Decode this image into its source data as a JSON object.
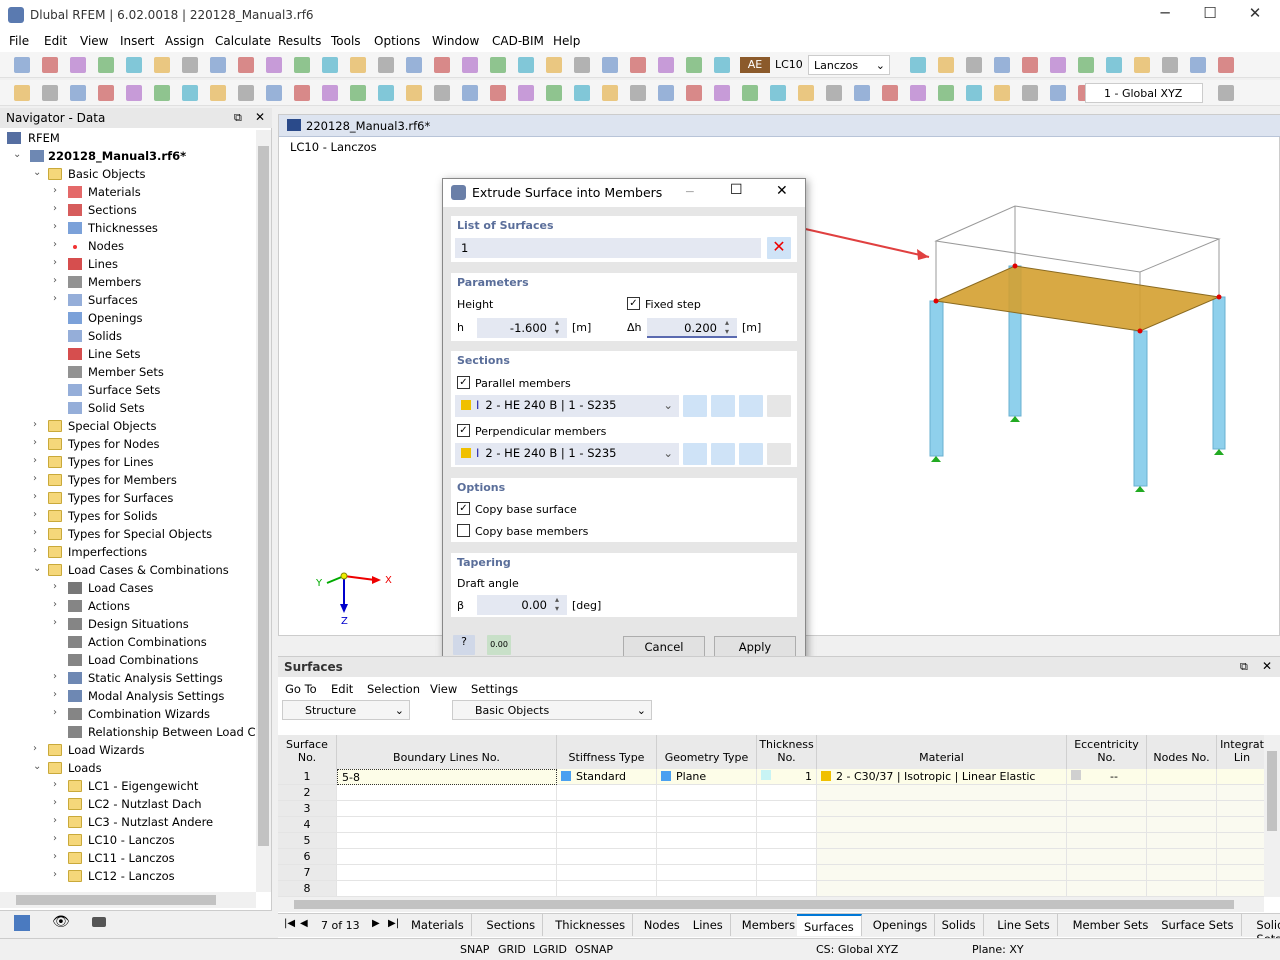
{
  "window": {
    "title": "Dlubal RFEM | 6.02.0018 | 220128_Manual3.rf6",
    "minimize": "─",
    "maximize": "☐",
    "close": "✕"
  },
  "menu": [
    "File",
    "Edit",
    "View",
    "Insert",
    "Assign",
    "Calculate",
    "Results",
    "Tools",
    "Options",
    "Window",
    "CAD-BIM",
    "Help"
  ],
  "toolbar": {
    "load_badge": "AE",
    "load_case": "LC10",
    "load_name": "Lanczos",
    "coord_system": "1 - Global XYZ"
  },
  "navigator": {
    "title": "Navigator - Data",
    "items": [
      {
        "label": "RFEM",
        "level": 0,
        "exp": "none",
        "icon": "rfem"
      },
      {
        "label": "220128_Manual3.rf6*",
        "level": 0,
        "exp": "open",
        "icon": "model",
        "bold": true
      },
      {
        "label": "Basic Objects",
        "level": 1,
        "exp": "open",
        "icon": "folder"
      },
      {
        "label": "Materials",
        "level": 2,
        "exp": "closed",
        "icon": "materials"
      },
      {
        "label": "Sections",
        "level": 2,
        "exp": "closed",
        "icon": "sections"
      },
      {
        "label": "Thicknesses",
        "level": 2,
        "exp": "closed",
        "icon": "thickness"
      },
      {
        "label": "Nodes",
        "level": 2,
        "exp": "closed",
        "icon": "node"
      },
      {
        "label": "Lines",
        "level": 2,
        "exp": "closed",
        "icon": "line"
      },
      {
        "label": "Members",
        "level": 2,
        "exp": "closed",
        "icon": "member"
      },
      {
        "label": "Surfaces",
        "level": 2,
        "exp": "closed",
        "icon": "surface"
      },
      {
        "label": "Openings",
        "level": 2,
        "exp": "none",
        "icon": "opening"
      },
      {
        "label": "Solids",
        "level": 2,
        "exp": "none",
        "icon": "solid"
      },
      {
        "label": "Line Sets",
        "level": 2,
        "exp": "none",
        "icon": "line"
      },
      {
        "label": "Member Sets",
        "level": 2,
        "exp": "none",
        "icon": "member"
      },
      {
        "label": "Surface Sets",
        "level": 2,
        "exp": "none",
        "icon": "surface"
      },
      {
        "label": "Solid Sets",
        "level": 2,
        "exp": "none",
        "icon": "solid"
      },
      {
        "label": "Special Objects",
        "level": 1,
        "exp": "closed",
        "icon": "folder"
      },
      {
        "label": "Types for Nodes",
        "level": 1,
        "exp": "closed",
        "icon": "folder"
      },
      {
        "label": "Types for Lines",
        "level": 1,
        "exp": "closed",
        "icon": "folder"
      },
      {
        "label": "Types for Members",
        "level": 1,
        "exp": "closed",
        "icon": "folder"
      },
      {
        "label": "Types for Surfaces",
        "level": 1,
        "exp": "closed",
        "icon": "folder"
      },
      {
        "label": "Types for Solids",
        "level": 1,
        "exp": "closed",
        "icon": "folder"
      },
      {
        "label": "Types for Special Objects",
        "level": 1,
        "exp": "closed",
        "icon": "folder"
      },
      {
        "label": "Imperfections",
        "level": 1,
        "exp": "closed",
        "icon": "folder"
      },
      {
        "label": "Load Cases & Combinations",
        "level": 1,
        "exp": "open",
        "icon": "folder"
      },
      {
        "label": "Load Cases",
        "level": 2,
        "exp": "closed",
        "icon": "loadcase"
      },
      {
        "label": "Actions",
        "level": 2,
        "exp": "closed",
        "icon": "action"
      },
      {
        "label": "Design Situations",
        "level": 2,
        "exp": "closed",
        "icon": "action"
      },
      {
        "label": "Action Combinations",
        "level": 2,
        "exp": "none",
        "icon": "action"
      },
      {
        "label": "Load Combinations",
        "level": 2,
        "exp": "none",
        "icon": "action"
      },
      {
        "label": "Static Analysis Settings",
        "level": 2,
        "exp": "closed",
        "icon": "static"
      },
      {
        "label": "Modal Analysis Settings",
        "level": 2,
        "exp": "closed",
        "icon": "static"
      },
      {
        "label": "Combination Wizards",
        "level": 2,
        "exp": "closed",
        "icon": "action"
      },
      {
        "label": "Relationship Between Load Cases",
        "level": 2,
        "exp": "none",
        "icon": "action"
      },
      {
        "label": "Load Wizards",
        "level": 1,
        "exp": "closed",
        "icon": "folder"
      },
      {
        "label": "Loads",
        "level": 1,
        "exp": "open",
        "icon": "folder"
      },
      {
        "label": "LC1 - Eigengewicht",
        "level": 2,
        "exp": "closed",
        "icon": "folder"
      },
      {
        "label": "LC2 - Nutzlast Dach",
        "level": 2,
        "exp": "closed",
        "icon": "folder"
      },
      {
        "label": "LC3 - Nutzlast Andere",
        "level": 2,
        "exp": "closed",
        "icon": "folder"
      },
      {
        "label": "LC10 - Lanczos",
        "level": 2,
        "exp": "closed",
        "icon": "folder"
      },
      {
        "label": "LC11 - Lanczos",
        "level": 2,
        "exp": "closed",
        "icon": "folder"
      },
      {
        "label": "LC12 - Lanczos",
        "level": 2,
        "exp": "closed",
        "icon": "folder"
      }
    ]
  },
  "view": {
    "tab": "220128_Manual3.rf6*",
    "caption": "LC10 - Lanczos",
    "axes": {
      "x": "X",
      "y": "Y",
      "z": "Z"
    }
  },
  "dialog": {
    "title": "Extrude Surface into Members",
    "list_of_surfaces": {
      "header": "List of Surfaces",
      "value": "1"
    },
    "parameters": {
      "header": "Parameters",
      "height_label": "Height",
      "h_label": "h",
      "h_value": "-1.600",
      "h_unit": "[m]",
      "fixed_step_label": "Fixed step",
      "fixed_step_checked": true,
      "dh_label": "Δh",
      "dh_value": "0.200",
      "dh_unit": "[m]"
    },
    "sections": {
      "header": "Sections",
      "parallel_label": "Parallel members",
      "parallel_checked": true,
      "parallel_section": "2 - HE 240 B | 1 - S235",
      "perpendicular_label": "Perpendicular members",
      "perpendicular_checked": true,
      "perpendicular_section": "2 - HE 240 B | 1 - S235"
    },
    "options": {
      "header": "Options",
      "copy_surface_label": "Copy base surface",
      "copy_surface_checked": true,
      "copy_members_label": "Copy base members",
      "copy_members_checked": false
    },
    "tapering": {
      "header": "Tapering",
      "draft_label": "Draft angle",
      "beta_label": "β",
      "beta_value": "0.00",
      "beta_unit": "[deg]"
    },
    "cancel": "Cancel",
    "apply": "Apply",
    "decimals_icon_text": "0.00"
  },
  "panel": {
    "title": "Surfaces",
    "menu": [
      "Go To",
      "Edit",
      "Selection",
      "View",
      "Settings"
    ],
    "structure_select": "Structure",
    "objects_select": "Basic Objects",
    "columns": [
      {
        "l1": "Surface",
        "l2": "No."
      },
      {
        "l1": "",
        "l2": "Boundary Lines No."
      },
      {
        "l1": "",
        "l2": "Stiffness Type"
      },
      {
        "l1": "",
        "l2": "Geometry Type"
      },
      {
        "l1": "Thickness",
        "l2": "No."
      },
      {
        "l1": "",
        "l2": "Material"
      },
      {
        "l1": "Eccentricity",
        "l2": "No."
      },
      {
        "l1": "",
        "l2": "Nodes No."
      },
      {
        "l1": "Integrat",
        "l2": "Lin"
      }
    ],
    "rows": [
      {
        "no": "1",
        "boundary": "5-8",
        "stiffness": "Standard",
        "geometry": "Plane",
        "thickness": "1",
        "material": "2 - C30/37 | Isotropic | Linear Elastic",
        "eccentricity": "--"
      },
      {
        "no": "2"
      },
      {
        "no": "3"
      },
      {
        "no": "4"
      },
      {
        "no": "5"
      },
      {
        "no": "6"
      },
      {
        "no": "7"
      },
      {
        "no": "8"
      }
    ],
    "pager": "7 of 13",
    "tabs": [
      "Materials",
      "Sections",
      "Thicknesses",
      "Nodes",
      "Lines",
      "Members",
      "Surfaces",
      "Openings",
      "Solids",
      "Line Sets",
      "Member Sets",
      "Surface Sets",
      "Solid Sets"
    ],
    "active_tab": "Surfaces"
  },
  "status": {
    "snap": "SNAP",
    "grid": "GRID",
    "lgrid": "LGRID",
    "osnap": "OSNAP",
    "cs": "CS: Global XYZ",
    "plane": "Plane: XY"
  },
  "colors": {
    "accent": "#0078d7",
    "surface": "#d4a030",
    "member": "#8fd0ec",
    "material": "#f0c000",
    "standard": "#4aa0f0"
  }
}
